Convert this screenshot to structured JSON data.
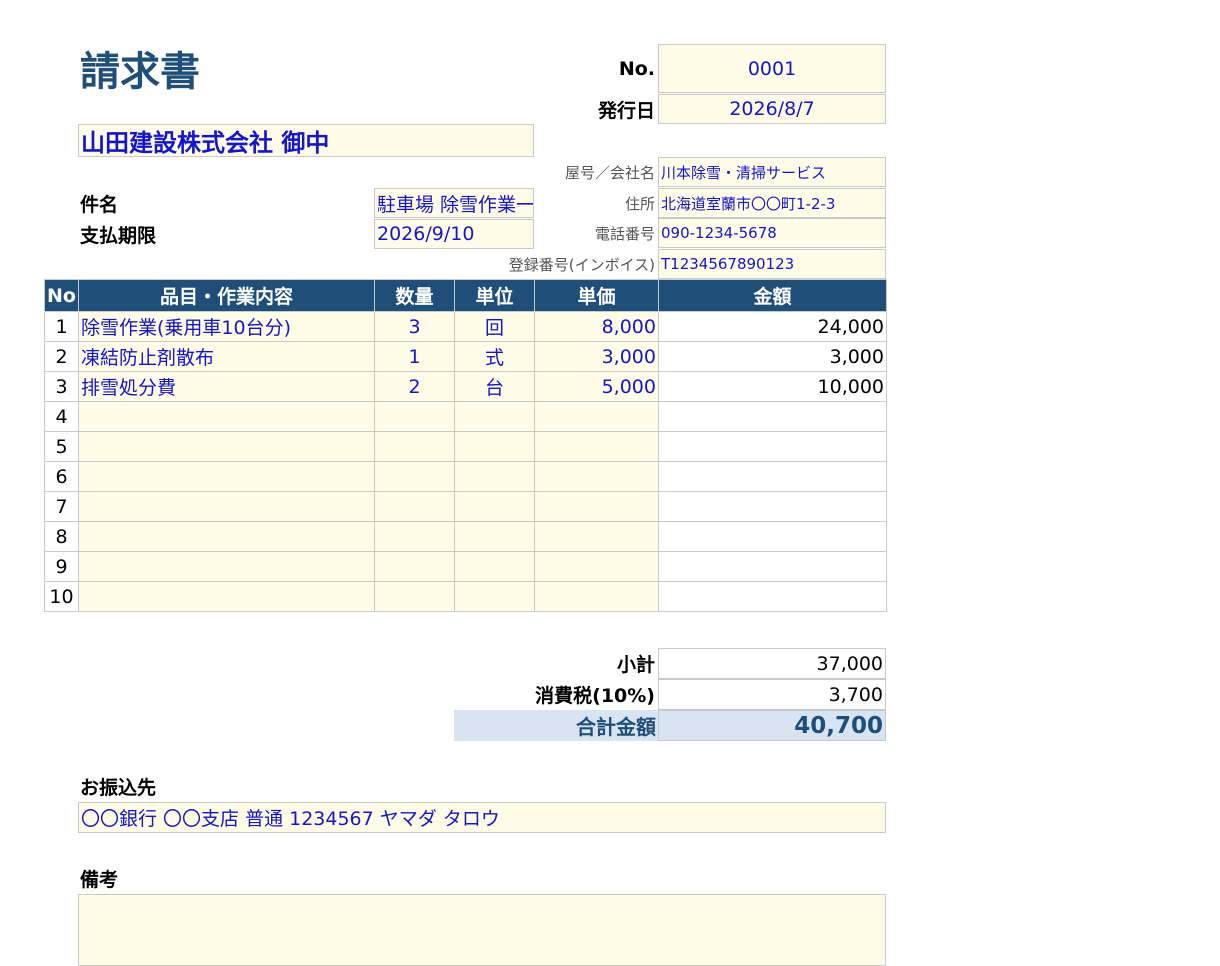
{
  "header": {
    "title": "請求書",
    "no_label": "No.",
    "no_value": "0001",
    "issue_label": "発行日",
    "issue_value": "2026/8/7"
  },
  "client": {
    "name": "山田建設株式会社 御中"
  },
  "subject": {
    "subject_label": "件名",
    "subject_value": "駐車場 除雪作業一式",
    "due_label": "支払期限",
    "due_value": "2026/9/10"
  },
  "issuer": {
    "company_label": "屋号／会社名",
    "company_value": "川本除雪・清掃サービス",
    "address_label": "住所",
    "address_value": "北海道室蘭市〇〇町1-2-3",
    "phone_label": "電話番号",
    "phone_value": "090-1234-5678",
    "reg_label": "登録番号(インボイス)",
    "reg_value": "T1234567890123"
  },
  "table": {
    "headers": [
      "No",
      "品目・作業内容",
      "数量",
      "単位",
      "単価",
      "金額"
    ],
    "rows": [
      {
        "no": "1",
        "item": "除雪作業(乗用車10台分)",
        "qty": "3",
        "unit": "回",
        "price": "8,000",
        "amount": "24,000"
      },
      {
        "no": "2",
        "item": "凍結防止剤散布",
        "qty": "1",
        "unit": "式",
        "price": "3,000",
        "amount": "3,000"
      },
      {
        "no": "3",
        "item": "排雪処分費",
        "qty": "2",
        "unit": "台",
        "price": "5,000",
        "amount": "10,000"
      },
      {
        "no": "4",
        "item": "",
        "qty": "",
        "unit": "",
        "price": "",
        "amount": ""
      },
      {
        "no": "5",
        "item": "",
        "qty": "",
        "unit": "",
        "price": "",
        "amount": ""
      },
      {
        "no": "6",
        "item": "",
        "qty": "",
        "unit": "",
        "price": "",
        "amount": ""
      },
      {
        "no": "7",
        "item": "",
        "qty": "",
        "unit": "",
        "price": "",
        "amount": ""
      },
      {
        "no": "8",
        "item": "",
        "qty": "",
        "unit": "",
        "price": "",
        "amount": ""
      },
      {
        "no": "9",
        "item": "",
        "qty": "",
        "unit": "",
        "price": "",
        "amount": ""
      },
      {
        "no": "10",
        "item": "",
        "qty": "",
        "unit": "",
        "price": "",
        "amount": ""
      }
    ]
  },
  "totals": {
    "subtotal_label": "小計",
    "subtotal_value": "37,000",
    "tax_label": "消費税(10%)",
    "tax_value": "3,700",
    "total_label": "合計金額",
    "total_value": "40,700"
  },
  "bank": {
    "label": "お振込先",
    "value": "〇〇銀行 〇〇支店 普通 1234567 ヤマダ タロウ"
  },
  "remarks": {
    "label": "備考",
    "value": ""
  },
  "colors": {
    "header_bg": "#1f4e79",
    "input_bg": "#fffde7",
    "input_text": "#1414d4",
    "total_bg": "#d9e4f2"
  }
}
